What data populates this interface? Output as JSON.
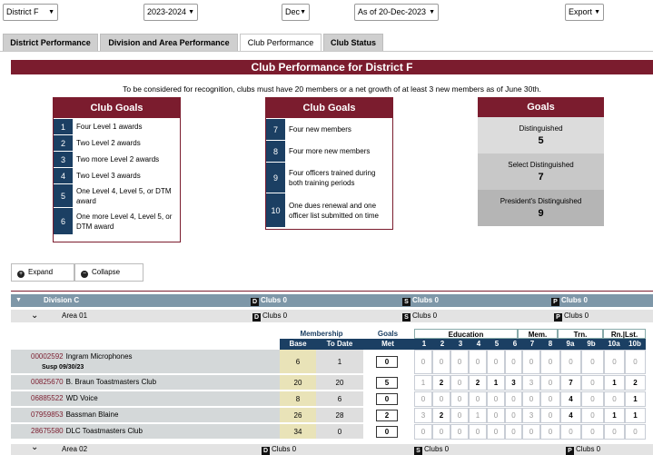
{
  "filters": {
    "district": "District F",
    "year": "2023-2024",
    "month": "Dec",
    "as_of": "As of 20-Dec-2023",
    "export": "Export"
  },
  "tabs": [
    "District Performance",
    "Division and Area Performance",
    "Club Performance",
    "Club Status"
  ],
  "page_title": "Club Performance for District F",
  "intro": "To be considered for recognition, clubs must have 20 members or a net growth of at least 3 new members as of June 30th.",
  "club_goals_left": {
    "title": "Club Goals",
    "items": [
      {
        "num": "1",
        "text": "Four Level 1 awards"
      },
      {
        "num": "2",
        "text": "Two Level 2 awards"
      },
      {
        "num": "3",
        "text": "Two more Level 2 awards"
      },
      {
        "num": "4",
        "text": "Two Level 3 awards"
      },
      {
        "num": "5",
        "text": "One Level 4, Level 5, or DTM award"
      },
      {
        "num": "6",
        "text": "One more Level 4, Level 5, or DTM award"
      }
    ]
  },
  "club_goals_right": {
    "title": "Club Goals",
    "items": [
      {
        "num": "7",
        "text": "Four new members"
      },
      {
        "num": "8",
        "text": "Four more new members"
      },
      {
        "num": "9",
        "text": "Four officers trained during both training periods"
      },
      {
        "num": "10",
        "text": "One dues renewal and one officer list submitted on time"
      }
    ]
  },
  "goals_panel": {
    "title": "Goals",
    "levels": [
      {
        "label": "Distinguished",
        "value": "5",
        "color": "#dcdcdc"
      },
      {
        "label": "Select Distinguished",
        "value": "7",
        "color": "#c8c8c8"
      },
      {
        "label": "President's Distinguished",
        "value": "9",
        "color": "#b5b5b5"
      }
    ]
  },
  "buttons": {
    "expand": "Expand",
    "collapse": "Collapse"
  },
  "division": {
    "name": "Division C",
    "d_label": "D",
    "d_clubs": "Clubs 0",
    "s_label": "S",
    "s_clubs": "Clubs 0",
    "p_label": "P",
    "p_clubs": "Clubs 0"
  },
  "area1": {
    "name": "Area 01",
    "d_clubs": "Clubs 0",
    "s_clubs": "Clubs 0",
    "p_clubs": "Clubs 0"
  },
  "area2": {
    "name": "Area 02",
    "d_clubs": "Clubs 0",
    "s_clubs": "Clubs 0",
    "p_clubs": "Clubs 0"
  },
  "table": {
    "membership": "Membership",
    "goals": "Goals",
    "education": "Education",
    "mem": "Mem.",
    "trn": "Trn.",
    "rnlst": "Rn.|Lst.",
    "base": "Base",
    "to_date": "To Date",
    "met": "Met",
    "cols": [
      "1",
      "2",
      "3",
      "4",
      "5",
      "6",
      "7",
      "8",
      "9a",
      "9b",
      "10a",
      "10b"
    ]
  },
  "clubs": [
    {
      "id": "00002592",
      "name": "Ingram Microphones",
      "note": "Susp 09/30/23",
      "base": "6",
      "to_date": "1",
      "met": "0",
      "vals": [
        "0",
        "0",
        "0",
        "0",
        "0",
        "0",
        "0",
        "0",
        "0",
        "0",
        "0",
        "0"
      ],
      "bold": [
        false,
        false,
        false,
        false,
        false,
        false,
        false,
        false,
        false,
        false,
        false,
        false
      ]
    },
    {
      "id": "00825670",
      "name": "B. Braun Toastmasters Club",
      "note": "",
      "base": "20",
      "to_date": "20",
      "met": "5",
      "vals": [
        "1",
        "2",
        "0",
        "2",
        "1",
        "3",
        "3",
        "0",
        "7",
        "0",
        "1",
        "2"
      ],
      "bold": [
        false,
        true,
        false,
        true,
        true,
        true,
        false,
        false,
        true,
        false,
        true,
        true
      ]
    },
    {
      "id": "06885522",
      "name": "WD Voice",
      "note": "",
      "base": "8",
      "to_date": "6",
      "met": "0",
      "vals": [
        "0",
        "0",
        "0",
        "0",
        "0",
        "0",
        "0",
        "0",
        "4",
        "0",
        "0",
        "1"
      ],
      "bold": [
        false,
        false,
        false,
        false,
        false,
        false,
        false,
        false,
        true,
        false,
        false,
        true
      ]
    },
    {
      "id": "07959853",
      "name": "Bassman Blaine",
      "note": "",
      "base": "26",
      "to_date": "28",
      "met": "2",
      "vals": [
        "3",
        "2",
        "0",
        "1",
        "0",
        "0",
        "3",
        "0",
        "4",
        "0",
        "1",
        "1"
      ],
      "bold": [
        false,
        true,
        false,
        false,
        false,
        false,
        false,
        false,
        true,
        false,
        true,
        true
      ]
    },
    {
      "id": "28675580",
      "name": "DLC Toastmasters Club",
      "note": "",
      "base": "34",
      "to_date": "0",
      "met": "0",
      "vals": [
        "0",
        "0",
        "0",
        "0",
        "0",
        "0",
        "0",
        "0",
        "0",
        "0",
        "0",
        "0"
      ],
      "bold": [
        false,
        false,
        false,
        false,
        false,
        false,
        false,
        false,
        false,
        false,
        false,
        false
      ]
    }
  ]
}
